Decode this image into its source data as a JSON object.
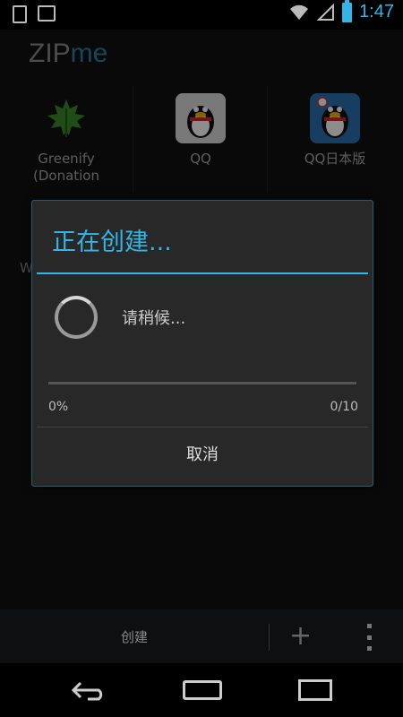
{
  "status_bar": {
    "time": "1:47",
    "icons": [
      "download-icon",
      "image-icon",
      "wifi-icon",
      "signal-icon",
      "battery-icon"
    ]
  },
  "app": {
    "logo_part1": "ZIP",
    "logo_part2": "me"
  },
  "apps": [
    {
      "label": "Greenify\n(Donation",
      "icon": "leaf-icon"
    },
    {
      "label": "QQ",
      "icon": "penguin-icon"
    },
    {
      "label": "QQ日本版",
      "icon": "penguin-icon"
    }
  ],
  "partial_label": "W",
  "dialog": {
    "title": "正在创建...",
    "message": "请稍候...",
    "progress_fraction": 0,
    "percent_text": "0%",
    "count_text": "0/10",
    "cancel_label": "取消"
  },
  "action_bar": {
    "create_label": "创建",
    "plus": "+"
  },
  "colors": {
    "accent": "#33b5e5"
  }
}
